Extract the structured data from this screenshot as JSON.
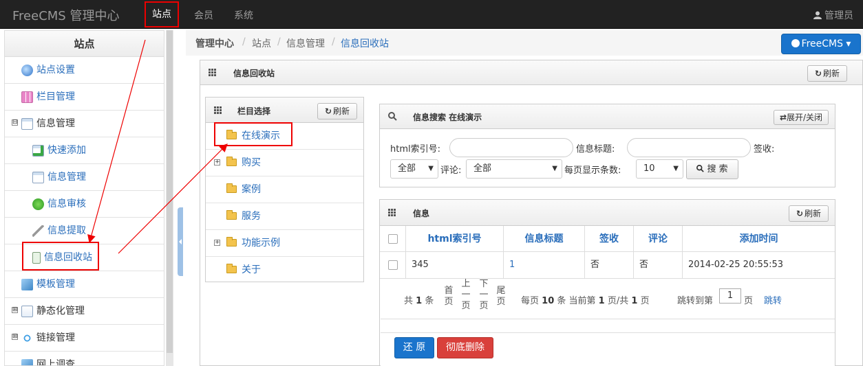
{
  "navbar": {
    "brand": "FreeCMS 管理中心",
    "items": [
      "站点",
      "会员",
      "系统"
    ],
    "user": "管理员"
  },
  "sidebar": {
    "title": "站点",
    "items": [
      {
        "label": "站点设置",
        "icon": "globe-icon"
      },
      {
        "label": "栏目管理",
        "icon": "column-icon"
      },
      {
        "label": "信息管理",
        "icon": "window-icon",
        "toggle": "⊟"
      },
      {
        "label": "快速添加",
        "icon": "add-window-icon"
      },
      {
        "label": "信息管理",
        "icon": "window-icon"
      },
      {
        "label": "信息审核",
        "icon": "play-icon"
      },
      {
        "label": "信息提取",
        "icon": "extract-icon"
      },
      {
        "label": "信息回收站",
        "icon": "recycle-icon"
      },
      {
        "label": "模板管理",
        "icon": "template-icon"
      },
      {
        "label": "静态化管理",
        "icon": "static-icon",
        "toggle": "⊞"
      },
      {
        "label": "链接管理",
        "icon": "link-icon",
        "toggle": "⊞"
      },
      {
        "label": "网上调查",
        "icon": "survey-icon"
      }
    ]
  },
  "breadcrumb": [
    "管理中心",
    "站点",
    "信息管理",
    "信息回收站"
  ],
  "breadcrumb_sep": "/",
  "freecms_button": "FreeCMS ▾",
  "main_panel": {
    "title": "信息回收站",
    "refresh": "刷新"
  },
  "column_panel": {
    "title": "栏目选择",
    "refresh": "刷新",
    "items": [
      "在线演示",
      "购买",
      "案例",
      "服务",
      "功能示例",
      "关于"
    ]
  },
  "search_panel": {
    "title": "信息搜索 在线演示",
    "toggle_button": "展开/关闭",
    "html_index_label": "html索引号:",
    "title_label": "信息标题:",
    "sign_label": "签收:",
    "sign_value": "全部",
    "comment_label": "评论:",
    "comment_value": "全部",
    "page_size_label": "每页显示条数:",
    "page_size_value": "10",
    "search_button": "搜 索"
  },
  "info_panel": {
    "title": "信息",
    "refresh": "刷新",
    "columns": [
      "html索引号",
      "信息标题",
      "签收",
      "评论",
      "添加时间"
    ],
    "rows": [
      {
        "html_index": "345",
        "title": "1",
        "sign": "否",
        "comment": "否",
        "added": "2014-02-25 20:55:53"
      }
    ]
  },
  "pager": {
    "total_prefix": "共",
    "total": "1",
    "total_suffix": "条",
    "first": "首页",
    "prev": "上一页",
    "next": "下一页",
    "last": "尾页",
    "per_page_prefix": "每页",
    "per_page": "10",
    "per_page_mid": "条 当前第",
    "current": "1",
    "pages_mid": "页/共",
    "pages": "1",
    "pages_suffix": "页",
    "jump_label": "跳转到第",
    "jump_value": "1",
    "jump_suffix": "页",
    "jump_button": "跳转"
  },
  "actions": {
    "restore": "还 原",
    "delete": "彻底删除"
  },
  "colors": {
    "accent": "#2a6ebb",
    "primary_button": "#1a74cc",
    "danger_button": "#d9403b",
    "annotation": "#e00000"
  }
}
